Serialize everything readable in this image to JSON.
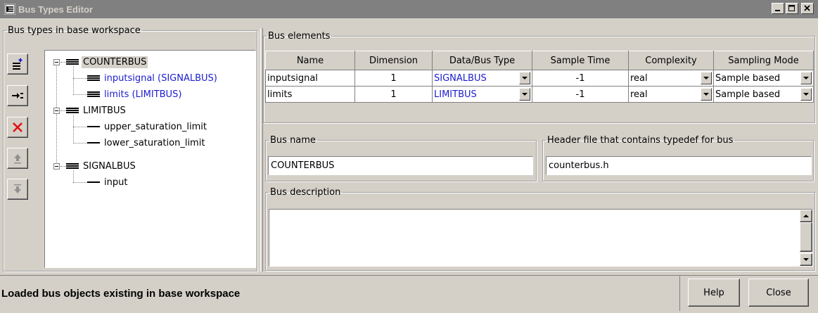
{
  "window": {
    "title": "Bus Types Editor",
    "buttons": [
      "minimize",
      "maximize",
      "close"
    ]
  },
  "left_panel": {
    "title": "Bus types in base workspace",
    "tools": [
      {
        "name": "add-bus-icon"
      },
      {
        "name": "add-element-icon"
      },
      {
        "name": "delete-icon"
      },
      {
        "name": "move-up-icon"
      },
      {
        "name": "move-down-icon"
      }
    ],
    "tree": {
      "counterbus": "COUNTERBUS",
      "counterbus_children": [
        "inputsignal  (SIGNALBUS)",
        "limits  (LIMITBUS)"
      ],
      "limitbus": "LIMITBUS",
      "limitbus_children": [
        "upper_saturation_limit",
        "lower_saturation_limit"
      ],
      "signalbus": "SIGNALBUS",
      "signalbus_children": [
        "input"
      ]
    }
  },
  "bus_elements": {
    "title": "Bus elements",
    "columns": [
      "Name",
      "Dimension",
      "Data/Bus Type",
      "Sample Time",
      "Complexity",
      "Sampling Mode"
    ],
    "rows": [
      {
        "name": "inputsignal",
        "dimension": "1",
        "type": "SIGNALBUS",
        "sample_time": "-1",
        "complexity": "real",
        "sampling_mode": "Sample based"
      },
      {
        "name": "limits",
        "dimension": "1",
        "type": "LIMITBUS",
        "sample_time": "-1",
        "complexity": "real",
        "sampling_mode": "Sample based"
      }
    ]
  },
  "bus_name": {
    "title": "Bus name",
    "value": "COUNTERBUS"
  },
  "header_file": {
    "title": "Header file that contains typedef for bus",
    "value": "counterbus.h"
  },
  "bus_description": {
    "title": "Bus description",
    "value": ""
  },
  "status": {
    "text": "Loaded bus objects existing in base workspace"
  },
  "footer": {
    "help": "Help",
    "close": "Close"
  },
  "colors": {
    "link_blue": "#1c1cd0",
    "background": "#d4d0c8",
    "titlebar": "#808080"
  }
}
